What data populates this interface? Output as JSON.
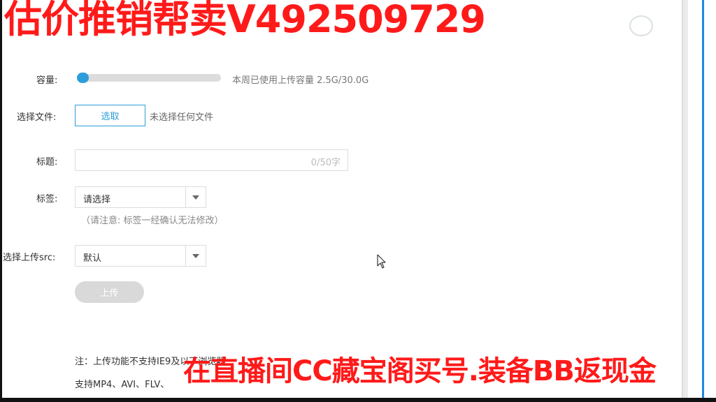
{
  "watermark": {
    "top_text": "估价推销帮卖V492509729",
    "bottom_text": "在直播间CC藏宝阁买号.装备BB返现金"
  },
  "form": {
    "capacity": {
      "label": "容量:",
      "usage_text": "本周已使用上传容量 2.5G/30.0G",
      "used_fraction": 0.083
    },
    "file": {
      "label": "选择文件:",
      "button_label": "选取",
      "status": "未选择任何文件"
    },
    "title": {
      "label": "标题:",
      "value": "",
      "counter": "0/50字"
    },
    "tags": {
      "label": "标签:",
      "selected": "请选择",
      "hint": "（请注意: 标签一经确认无法修改）"
    },
    "src": {
      "label": "选择上传src:",
      "selected": "默认"
    },
    "upload_button": "上传"
  },
  "notes": {
    "line1": "注：上传功能不支持IE9及以下浏览器",
    "line2": "支持MP4、AVI、FLV、"
  },
  "colors": {
    "accent": "#2d9cdb",
    "watermark": "#ff1a1a",
    "disabled_button": "#d9d9d9"
  },
  "icons": {
    "cursor": "arrow-cursor-icon",
    "dropdown": "caret-down-icon"
  }
}
